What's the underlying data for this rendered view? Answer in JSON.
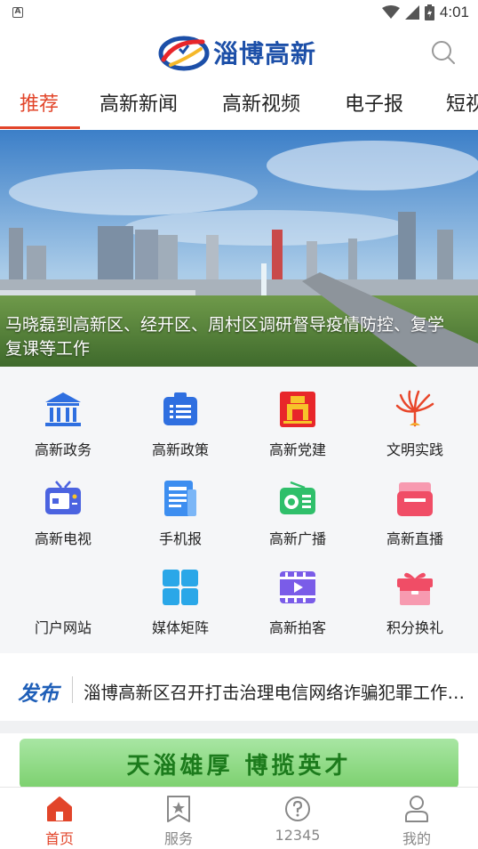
{
  "status_bar": {
    "time": "4:01"
  },
  "header": {
    "logo_text": "淄博高新"
  },
  "tabs": [
    {
      "label": "推荐"
    },
    {
      "label": "高新新闻"
    },
    {
      "label": "高新视频"
    },
    {
      "label": "电子报"
    },
    {
      "label": "短视"
    }
  ],
  "banner": {
    "caption": "马晓磊到高新区、经开区、周村区调研督导疫情防控、复学复课等工作"
  },
  "grid": [
    {
      "label": "高新政务",
      "icon": "government-building-icon",
      "color": "#2f6fe0"
    },
    {
      "label": "高新政策",
      "icon": "policy-document-icon",
      "color": "#2f6fe0"
    },
    {
      "label": "高新党建",
      "icon": "party-building-icon",
      "color": "#e8262a"
    },
    {
      "label": "文明实践",
      "icon": "civilization-practice-icon",
      "color": "#e8462a"
    },
    {
      "label": "高新电视",
      "icon": "tv-icon",
      "color": "#4b63e0"
    },
    {
      "label": "手机报",
      "icon": "mobile-newspaper-icon",
      "color": "#3d8ef0"
    },
    {
      "label": "高新广播",
      "icon": "radio-icon",
      "color": "#2fbf6a"
    },
    {
      "label": "高新直播",
      "icon": "live-stream-icon",
      "color": "#f04d66"
    },
    {
      "label": "门户网站",
      "icon": "portal-website-icon",
      "color": "#f58a2a"
    },
    {
      "label": "媒体矩阵",
      "icon": "media-matrix-icon",
      "color": "#2aa7e8"
    },
    {
      "label": "高新拍客",
      "icon": "video-clip-icon",
      "color": "#7a5ce8"
    },
    {
      "label": "积分换礼",
      "icon": "gift-icon",
      "color": "#f04d66"
    }
  ],
  "ticker": {
    "brand": "发布",
    "text": "淄博高新区召开打击治理电信网络诈骗犯罪工作推进会"
  },
  "ad_banner": {
    "text": "天淄雄厚  博揽英才"
  },
  "bottom_nav": [
    {
      "label": "首页",
      "icon": "home-icon"
    },
    {
      "label": "服务",
      "icon": "service-bookmark-icon"
    },
    {
      "label": "12345",
      "icon": "help-question-icon"
    },
    {
      "label": "我的",
      "icon": "user-profile-icon"
    }
  ],
  "colors": {
    "accent": "#e2452a",
    "brand_blue": "#1c4fa8"
  }
}
